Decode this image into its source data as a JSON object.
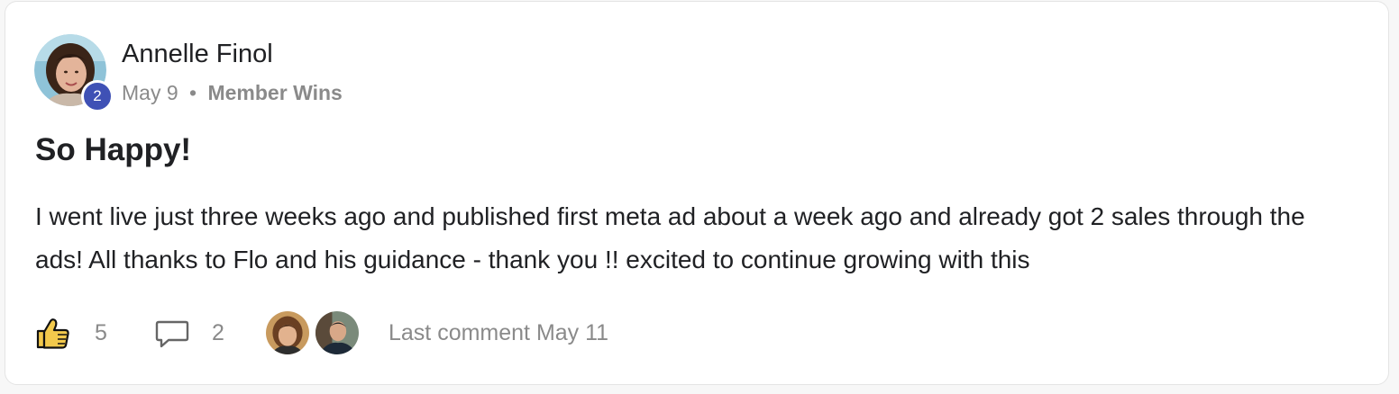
{
  "post": {
    "author": {
      "name": "Annelle Finol",
      "level": "2"
    },
    "date": "May 9",
    "separator": "•",
    "category": "Member Wins",
    "title": "So Happy!",
    "body": "I went live just three weeks ago and published first meta ad about a week ago and already got 2 sales through the ads! All thanks to Flo and his guidance - thank you !! excited to continue growing with this"
  },
  "footer": {
    "likes": "5",
    "comments": "2",
    "last_comment": "Last comment May 11"
  },
  "icons": {
    "like": "thumbs-up-icon",
    "comment": "comment-bubble-icon"
  },
  "colors": {
    "level_badge": "#3f51b5",
    "like_icon": "#f2c94c",
    "muted_text": "#8a8a8a",
    "primary_text": "#202124"
  }
}
